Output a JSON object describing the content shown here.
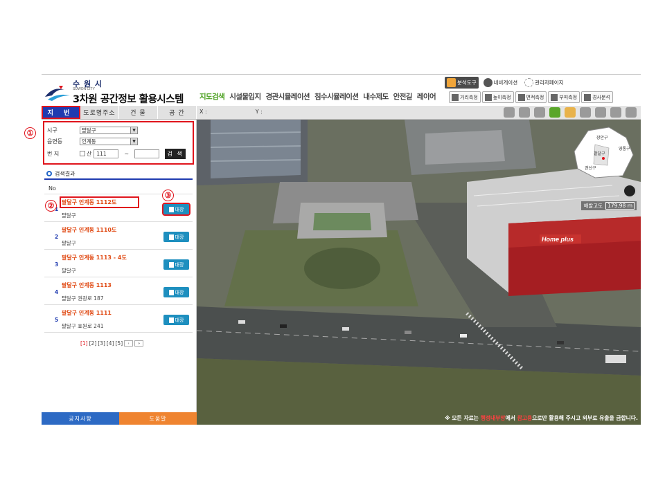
{
  "header": {
    "city_name": "수 원 시",
    "city_sub": "SUWON CITY",
    "system_title": "3차원 공간정보 활용시스템"
  },
  "main_menu": [
    "지도검색",
    "시설물입지",
    "경관시뮬레이션",
    "침수시뮬레이션",
    "내수제도",
    "안전길",
    "레이어"
  ],
  "top_tools": [
    "분석도구",
    "네비게이션",
    "관리자페이지"
  ],
  "analysis_tools": [
    "거리측정",
    "높이측정",
    "면적측정",
    "부피측정",
    "경사분석"
  ],
  "search_tabs": [
    "지 번",
    "도로명주소",
    "건 물",
    "공 간"
  ],
  "search_form": {
    "sigu_label": "시구",
    "sigu_value": "팔달구",
    "dong_label": "읍면동",
    "dong_value": "인계동",
    "jibun_label": "번 지",
    "san_label": "산",
    "jibun_main": "111",
    "dash": "~",
    "jibun_sub": "",
    "search_button": "검 색"
  },
  "badges": [
    "①",
    "②",
    "③"
  ],
  "results": {
    "heading": "검색결과",
    "no_header": "No",
    "ledger_label": "대장",
    "rows": [
      {
        "no": "1",
        "title": "팔달구 인계동 1112도",
        "road": "팔달구"
      },
      {
        "no": "2",
        "title": "팔달구 인계동 1110도",
        "road": "팔달구"
      },
      {
        "no": "3",
        "title": "팔달구 인계동 1113 - 4도",
        "road": "팔달구"
      },
      {
        "no": "4",
        "title": "팔달구 인계동 1113",
        "road": "팔달구 권광로 187"
      },
      {
        "no": "5",
        "title": "팔달구 인계동 1111",
        "road": "팔달구 효원로 241"
      }
    ],
    "pager": [
      "[1]",
      "[2]",
      "[3]",
      "[4]",
      "[5]"
    ],
    "pager_next": "›",
    "pager_last": "»"
  },
  "left_bottom": {
    "notice": "공지사항",
    "help": "도움말"
  },
  "map": {
    "coord_x_label": "X :",
    "coord_y_label": "Y :",
    "minimap_labels": [
      "장안구",
      "팔달구",
      "권선구",
      "영통구"
    ],
    "altitude_label": "해발고도",
    "altitude_value": "179.98 m",
    "store_sign": "Home plus",
    "disclaimer_pre": "※ 모든 자료는",
    "disclaimer_red1": "행정내부망",
    "disclaimer_mid": "에서",
    "disclaimer_red2": "참고용",
    "disclaimer_post": "으로만 활용해 주시고 외부로 유출을 금합니다."
  },
  "colors": {
    "accent_blue": "#1f3bb0",
    "highlight_red": "#e0141c",
    "result_orange": "#e04a14",
    "ledger_teal": "#1e8fbf",
    "menu_active_green": "#4aa01e"
  }
}
